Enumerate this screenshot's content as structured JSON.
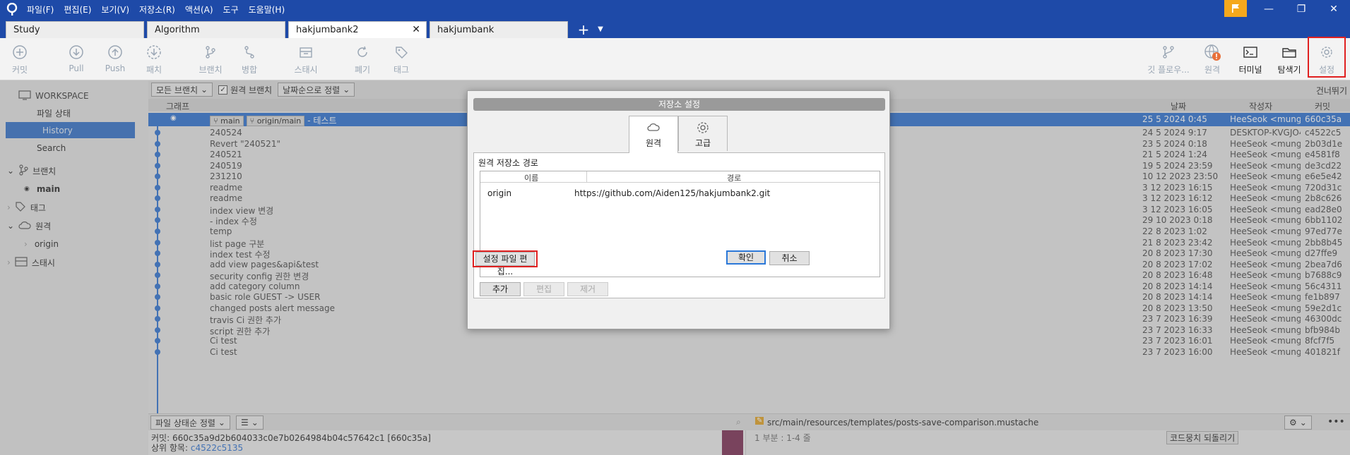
{
  "menu": [
    "파일(F)",
    "편집(E)",
    "보기(V)",
    "저장소(R)",
    "액션(A)",
    "도구",
    "도움말(H)"
  ],
  "tabs": [
    {
      "label": "Study"
    },
    {
      "label": "Algorithm"
    },
    {
      "label": "hakjumbank2",
      "active": true
    },
    {
      "label": "hakjumbank"
    }
  ],
  "toolbar": {
    "commit": "커밋",
    "pull": "Pull",
    "push": "Push",
    "fetch": "패치",
    "branch": "브랜치",
    "merge": "병합",
    "stash": "스태시",
    "discard": "폐기",
    "tag": "태그",
    "gitflow": "깃 플로우...",
    "remote": "원격",
    "terminal": "터미널",
    "explorer": "탐색기",
    "settings": "설정"
  },
  "sidebar": {
    "workspace": "WORKSPACE",
    "file_status": "파일 상태",
    "history": "History",
    "search": "Search",
    "branches": "브랜치",
    "branch_main": "main",
    "tags": "태그",
    "remotes": "원격",
    "remote_origin": "origin",
    "stashes": "스태시"
  },
  "filterbar": {
    "all_branches": "모든 브랜치",
    "remote_branches": "원격 브랜치",
    "sort": "날짜순으로 정렬",
    "skip": "건너뛰기"
  },
  "columns": {
    "graph": "그래프",
    "date": "날짜",
    "author": "작성자",
    "commit": "커밋"
  },
  "head_commit": {
    "tag_main": "main",
    "tag_origin": "origin/main",
    "message": "- 테스트",
    "date": "25 5 2024 0:45",
    "author": "HeeSeok <mung",
    "hash": "660c35a"
  },
  "commits": [
    {
      "message": "240524",
      "date": "24 5 2024 9:17",
      "author": "DESKTOP-KVGJO4",
      "hash": "c4522c5"
    },
    {
      "message": "Revert \"240521\"",
      "date": "23 5 2024 0:18",
      "author": "HeeSeok <mungn",
      "hash": "2b03d1e"
    },
    {
      "message": "240521",
      "date": "21 5 2024 1:24",
      "author": "HeeSeok <mungn",
      "hash": "e4581f8"
    },
    {
      "message": "240519",
      "date": "19 5 2024 23:59",
      "author": "HeeSeok <mungn",
      "hash": "de3cd22"
    },
    {
      "message": "231210",
      "date": "10 12 2023 23:50",
      "author": "HeeSeok <mungn",
      "hash": "e6e5e42"
    },
    {
      "message": "readme",
      "date": "3 12 2023 16:15",
      "author": "HeeSeok <mungn",
      "hash": "720d31c"
    },
    {
      "message": "readme",
      "date": "3 12 2023 16:12",
      "author": "HeeSeok <mungn",
      "hash": "2b8c626"
    },
    {
      "message": "index view 변경",
      "date": "3 12 2023 16:05",
      "author": "HeeSeok <mungn",
      "hash": "ead28e0"
    },
    {
      "message": "- index 수정",
      "date": "29 10 2023 0:18",
      "author": "HeeSeok <mungn",
      "hash": "6bb1102"
    },
    {
      "message": "temp",
      "date": "22 8 2023 1:02",
      "author": "HeeSeok <mungn",
      "hash": "97ed77e"
    },
    {
      "message": "list page 구분",
      "date": "21 8 2023 23:42",
      "author": "HeeSeok <mungn",
      "hash": "2bb8b45"
    },
    {
      "message": "index test 수정",
      "date": "20 8 2023 17:30",
      "author": "HeeSeok <mungn",
      "hash": "d27ffe9"
    },
    {
      "message": "add view pages&api&test",
      "date": "20 8 2023 17:02",
      "author": "HeeSeok <mungn",
      "hash": "2bea7d6"
    },
    {
      "message": "security config 권한 변경",
      "date": "20 8 2023 16:48",
      "author": "HeeSeok <mungn",
      "hash": "b7688c9"
    },
    {
      "message": "add category column",
      "date": "20 8 2023 14:14",
      "author": "HeeSeok <mungn",
      "hash": "56c4311"
    },
    {
      "message": "basic role GUEST -> USER",
      "date": "20 8 2023 14:14",
      "author": "HeeSeok <mungn",
      "hash": "fe1b897"
    },
    {
      "message": "changed posts alert message",
      "date": "20 8 2023 13:50",
      "author": "HeeSeok <mungn",
      "hash": "59e2d1c"
    },
    {
      "message": "travis Ci 권한 추가",
      "date": "23 7 2023 16:39",
      "author": "HeeSeok <mungn",
      "hash": "46300dc"
    },
    {
      "message": "script 권한 추가",
      "date": "23 7 2023 16:33",
      "author": "HeeSeok <mungn",
      "hash": "bfb984b"
    },
    {
      "message": "Ci test",
      "date": "23 7 2023 16:01",
      "author": "HeeSeok <mungn",
      "hash": "8fcf7f5"
    },
    {
      "message": "Ci test",
      "date": "23 7 2023 16:00",
      "author": "HeeSeok <mungn",
      "hash": "401821f"
    }
  ],
  "bottom": {
    "sort": "파일 상태순 정렬",
    "file_path": "src/main/resources/templates/posts-save-comparison.mustache",
    "commit_label": "커밋:",
    "commit_value": "660c35a9d2b604033c0e7b0264984b04c57642c1 [660c35a]",
    "parent_label": "상위 항목:",
    "parent_value": "c4522c5135",
    "hunk": "1 부분 : 1-4 줄",
    "revert_hunk": "코드뭉치 되돌리기"
  },
  "dialog": {
    "title": "저장소 설정",
    "tab_remote": "원격",
    "tab_advanced": "고급",
    "section": "원격 저장소 경로",
    "col_name": "이름",
    "col_path": "경로",
    "remotes": [
      {
        "name": "origin",
        "url": "https://github.com/Aiden125/hakjumbank2.git"
      }
    ],
    "add": "추가",
    "edit": "편집",
    "remove": "제거",
    "edit_config": "설정 파일 편집...",
    "ok": "확인",
    "cancel": "취소"
  }
}
